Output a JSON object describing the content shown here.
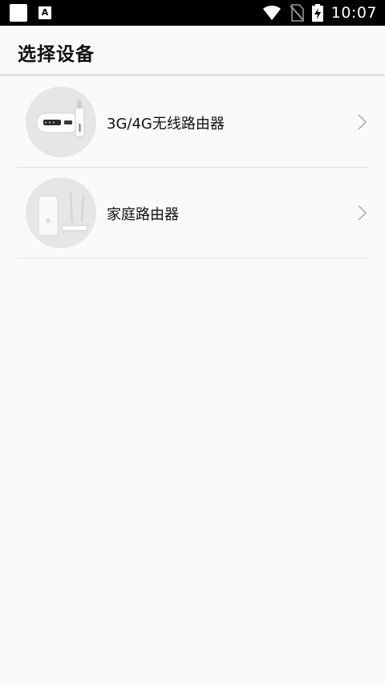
{
  "status_bar": {
    "time": "10:07",
    "notification_icons": [
      "app-square-icon",
      "app-a-icon"
    ],
    "a_icon_letter": "A",
    "system_icons": [
      "wifi-icon",
      "no-sim-icon",
      "battery-charging-icon"
    ]
  },
  "header": {
    "title": "选择设备"
  },
  "devices": [
    {
      "label": "3G/4G无线路由器",
      "icon": "mobile-wifi-router-icon"
    },
    {
      "label": "家庭路由器",
      "icon": "home-router-icon"
    }
  ],
  "colors": {
    "background": "#fafafa",
    "status_bar": "#000000",
    "divider": "#e1e1e1",
    "text": "#111111",
    "chevron": "#b5b5b5"
  }
}
